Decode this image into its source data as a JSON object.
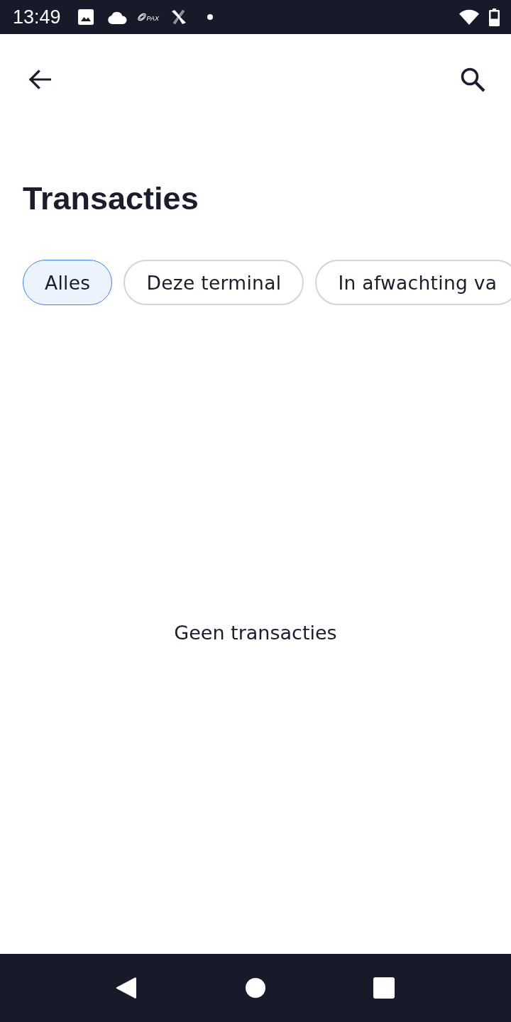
{
  "status_bar": {
    "time": "13:49",
    "logo_text": "PAX"
  },
  "page": {
    "title": "Transacties"
  },
  "filters": [
    {
      "label": "Alles",
      "selected": true
    },
    {
      "label": "Deze terminal",
      "selected": false
    },
    {
      "label": "In afwachting va",
      "selected": false
    }
  ],
  "empty_state": {
    "message": "Geen transacties"
  }
}
